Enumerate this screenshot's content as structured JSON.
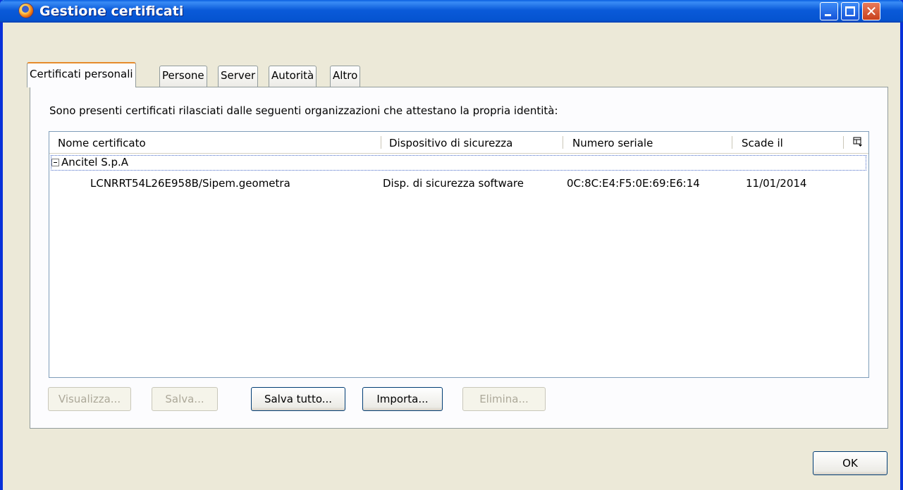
{
  "window": {
    "title": "Gestione certificati"
  },
  "tabs": [
    {
      "label": "Certificati personali",
      "active": true
    },
    {
      "label": "Persone",
      "active": false
    },
    {
      "label": "Server",
      "active": false
    },
    {
      "label": "Autorità",
      "active": false
    },
    {
      "label": "Altro",
      "active": false
    }
  ],
  "description": "Sono presenti certificati rilasciati dalle seguenti organizzazioni che attestano la propria identità:",
  "table": {
    "columns": [
      "Nome certificato",
      "Dispositivo di sicurezza",
      "Numero seriale",
      "Scade il"
    ],
    "groups": [
      {
        "name": "Ancitel S.p.A",
        "expanded": true,
        "rows": [
          {
            "name": "LCNRRT54L26E958B/Sipem.geometra",
            "device": "Disp. di sicurezza software",
            "serial": "0C:8C:E4:F5:0E:69:E6:14",
            "expires": "11/01/2014"
          }
        ]
      }
    ]
  },
  "buttons": {
    "view": "Visualizza...",
    "save": "Salva...",
    "save_all": "Salva tutto...",
    "import": "Importa...",
    "delete": "Elimina...",
    "ok": "OK"
  },
  "icons": {
    "app": "firefox-icon",
    "column_picker": "column-picker-icon",
    "twisty": "collapse-icon"
  }
}
